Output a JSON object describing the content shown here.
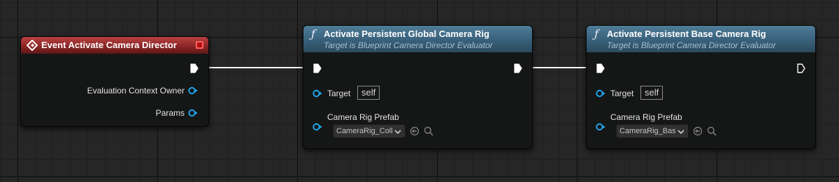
{
  "graph": {
    "event_node": {
      "title": "Event Activate Camera Director",
      "icon": "event-diamond-icon",
      "header_color": "#8c2626",
      "outputs": [
        {
          "label": "Evaluation Context Owner"
        },
        {
          "label": "Params"
        }
      ]
    },
    "nodes": [
      {
        "title": "Activate Persistent Global Camera Rig",
        "subtitle": "Target is Blueprint Camera Director Evaluator",
        "icon": "function-icon",
        "target_label": "Target",
        "target_value": "self",
        "prefab_label": "Camera Rig Prefab",
        "prefab_value": "CameraRig_Collisions"
      },
      {
        "title": "Activate Persistent Base Camera Rig",
        "subtitle": "Target is Blueprint Camera Director Evaluator",
        "icon": "function-icon",
        "target_label": "Target",
        "target_value": "self",
        "prefab_label": "Camera Rig Prefab",
        "prefab_value": "CameraRig_Base"
      }
    ],
    "colors": {
      "function_header": "#3c6580",
      "object_pin": "#1ca5e8",
      "exec_wire": "#ffffff"
    }
  }
}
